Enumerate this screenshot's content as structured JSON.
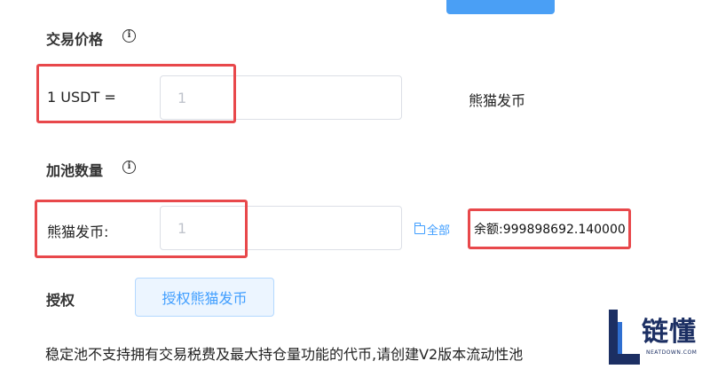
{
  "price": {
    "title": "交易价格",
    "prefix": "1 USDT =",
    "input_value": "1",
    "unit": "熊猫发币"
  },
  "pool": {
    "title": "加池数量",
    "token_label": "熊猫发币:",
    "input_value": "1",
    "all_link": "全部",
    "balance": "余额:999898692.140000"
  },
  "authorize": {
    "label": "授权",
    "button": "授权熊猫发币"
  },
  "notice": "稳定池不支持拥有交易税费及最大持仓量功能的代币,请创建V2版本流动性池",
  "logo": {
    "text": "链懂",
    "sub": "NEATDOWN.COM"
  },
  "colors": {
    "accent": "#409eff",
    "highlight_box": "#e8484b",
    "logo": "#1c2f63"
  },
  "icons": [
    "info-icon",
    "folder-icon"
  ]
}
